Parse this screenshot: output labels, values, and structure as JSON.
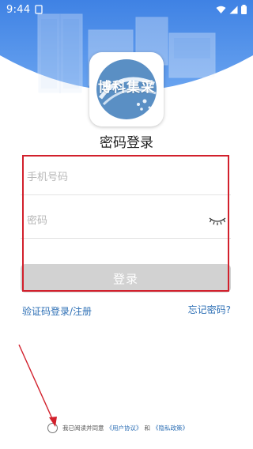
{
  "status_bar": {
    "time": "9:44"
  },
  "logo": {
    "text": "博科集采"
  },
  "page": {
    "title": "密码登录"
  },
  "form": {
    "phone_placeholder": "手机号码",
    "password_placeholder": "密码",
    "login_label": "登录"
  },
  "links": {
    "sms_login": "验证码登录/注册",
    "forgot_password": "忘记密码?"
  },
  "agreement": {
    "prefix": "我已阅读并同意",
    "user_agreement": "《用户协议》",
    "and": "和",
    "privacy_policy": "《隐私政策》"
  },
  "colors": {
    "hero_blue": "#4a8de8",
    "link_blue": "#2d6fb5",
    "highlight_red": "#d2202c",
    "button_disabled": "#d2d2d2"
  }
}
